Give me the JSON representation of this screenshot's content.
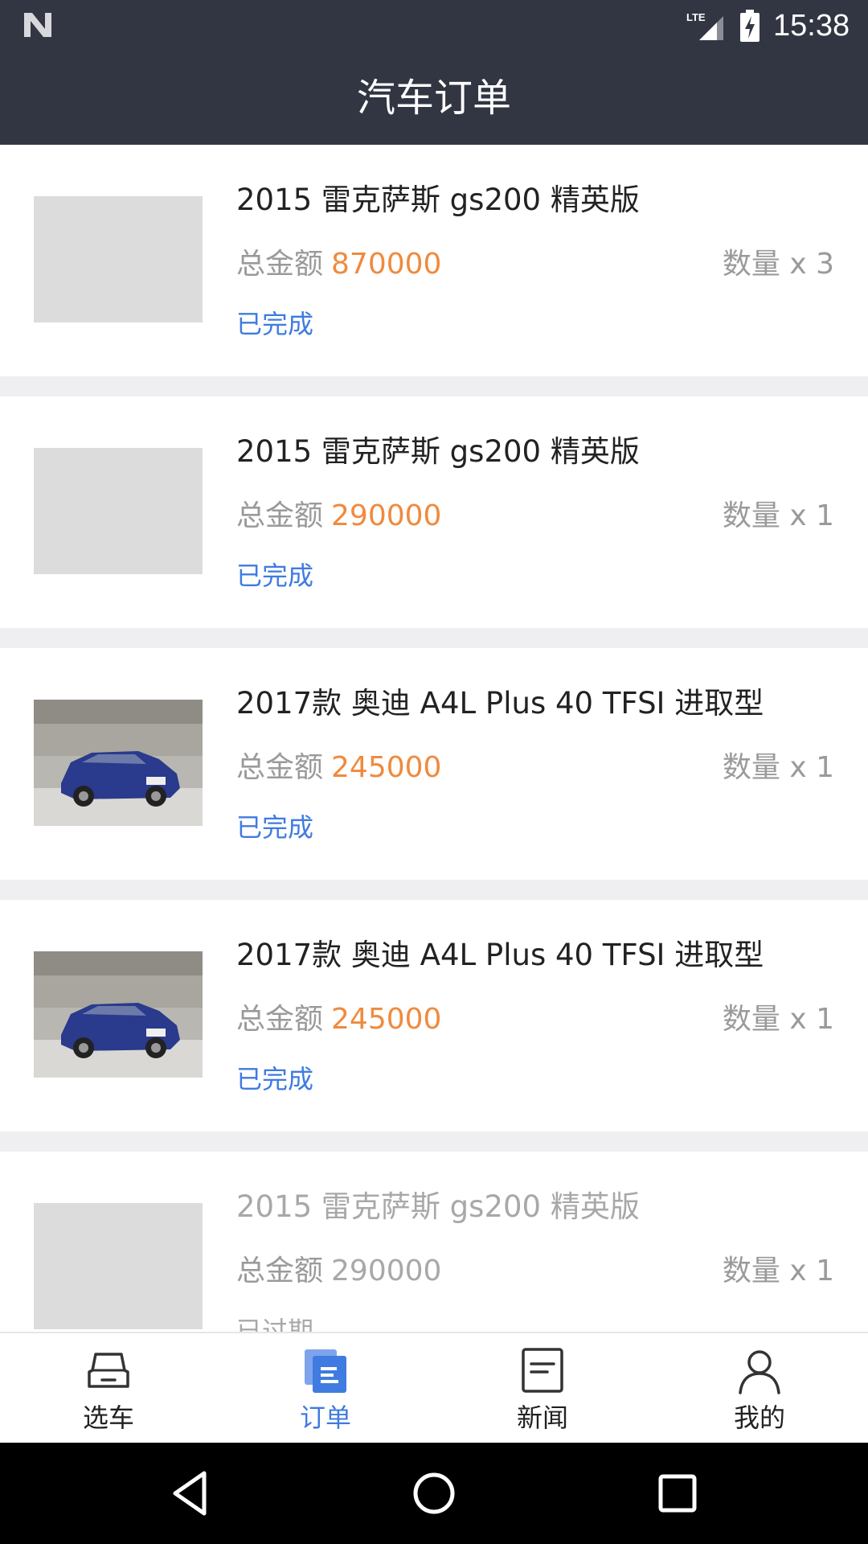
{
  "status_bar": {
    "time": "15:38",
    "network": "LTE",
    "icons": [
      "n-logo-icon",
      "lte-signal-icon",
      "battery-charging-icon"
    ]
  },
  "header": {
    "title": "汽车订单"
  },
  "orders": [
    {
      "name": "2015 雷克萨斯 gs200 精英版",
      "amount_label": "总金额",
      "amount": "870000",
      "quantity": "数量 x 3",
      "status": "已完成",
      "image": "placeholder"
    },
    {
      "name": "2015 雷克萨斯 gs200 精英版",
      "amount_label": "总金额",
      "amount": "290000",
      "quantity": "数量 x 1",
      "status": "已完成",
      "image": "placeholder"
    },
    {
      "name": "2017款 奥迪 A4L Plus 40 TFSI 进取型",
      "amount_label": "总金额",
      "amount": "245000",
      "quantity": "数量 x 1",
      "status": "已完成",
      "image": "car-photo"
    },
    {
      "name": "2017款 奥迪 A4L Plus 40 TFSI 进取型",
      "amount_label": "总金额",
      "amount": "245000",
      "quantity": "数量 x 1",
      "status": "已完成",
      "image": "car-photo"
    },
    {
      "name": "2015 雷克萨斯 gs200 精英版",
      "amount_label": "总金额",
      "amount": "290000",
      "quantity": "数量 x 1",
      "status": "已过期",
      "image": "placeholder"
    }
  ],
  "tabs": [
    {
      "label": "选车",
      "icon": "car-icon",
      "active": false
    },
    {
      "label": "订单",
      "icon": "orders-icon",
      "active": true
    },
    {
      "label": "新闻",
      "icon": "news-icon",
      "active": false
    },
    {
      "label": "我的",
      "icon": "profile-icon",
      "active": false
    }
  ],
  "colors": {
    "header_bg": "#323643",
    "accent_blue": "#3f7be0",
    "amount_orange": "#f08a3e",
    "secondary_text": "#9a9a9a"
  }
}
